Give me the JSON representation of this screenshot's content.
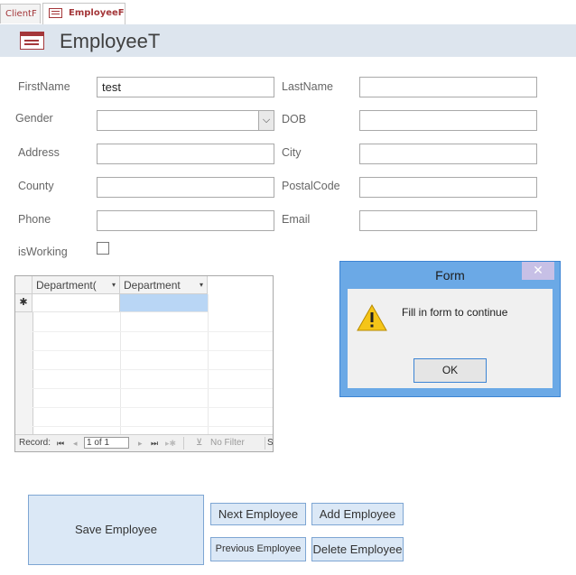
{
  "tabs": [
    {
      "label": "ClientF"
    },
    {
      "label": "EmployeeF"
    }
  ],
  "form_title": "EmployeeT",
  "fields": {
    "firstname": {
      "label": "FirstName",
      "value": "test"
    },
    "lastname": {
      "label": "LastName",
      "value": ""
    },
    "gender": {
      "label": "Gender",
      "value": ""
    },
    "dob": {
      "label": "DOB",
      "value": ""
    },
    "address": {
      "label": "Address",
      "value": ""
    },
    "city": {
      "label": "City",
      "value": ""
    },
    "county": {
      "label": "County",
      "value": ""
    },
    "postalcode": {
      "label": "PostalCode",
      "value": ""
    },
    "phone": {
      "label": "Phone",
      "value": ""
    },
    "email": {
      "label": "Email",
      "value": ""
    },
    "isworking": {
      "label": "isWorking",
      "checked": false
    }
  },
  "subform": {
    "columns": [
      "Department(",
      "Department"
    ],
    "new_row_marker": "✱",
    "nav": {
      "record_label": "Record:",
      "position": "1 of 1",
      "filter_label": "No Filter",
      "search_label": "S"
    }
  },
  "dialog": {
    "title": "Form",
    "close": "✕",
    "message": "Fill in form to continue",
    "ok_label": "OK"
  },
  "buttons": {
    "save": "Save Employee",
    "next": "Next Employee",
    "add": "Add Employee",
    "previous": "Previous Employee",
    "delete": "Delete Employee"
  },
  "colors": {
    "tab_text": "#a4373a",
    "header_bg": "#dde5ee",
    "dialog_border": "#6ba9e6",
    "button_bg": "#dbe8f6"
  }
}
